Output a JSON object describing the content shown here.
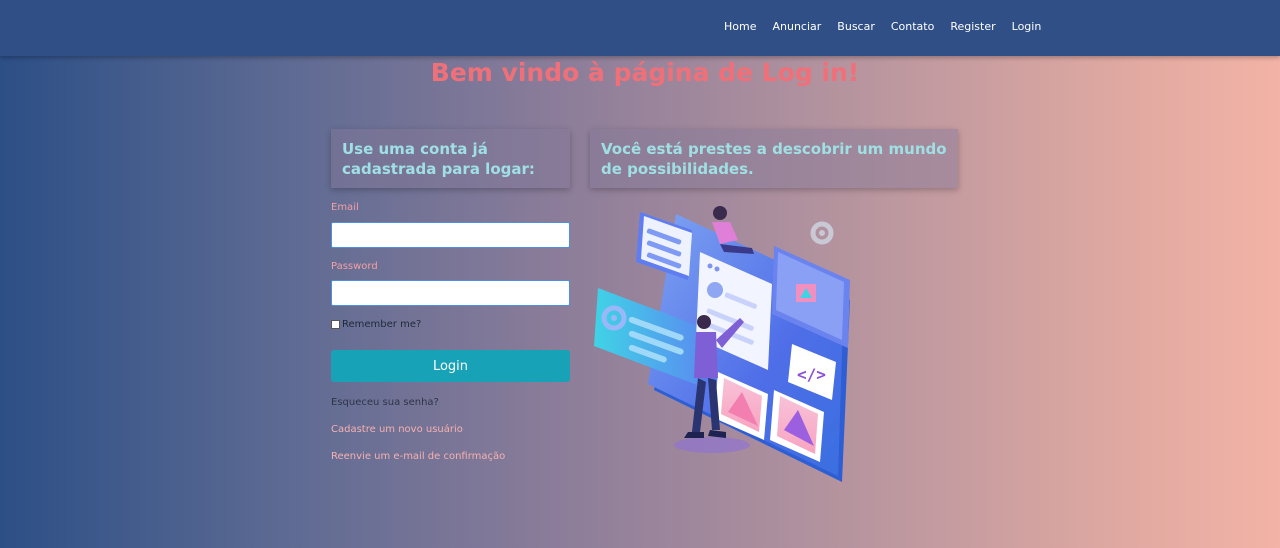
{
  "nav": {
    "items": [
      {
        "label": "Home"
      },
      {
        "label": "Anunciar"
      },
      {
        "label": "Buscar"
      },
      {
        "label": "Contato"
      },
      {
        "label": "Register"
      },
      {
        "label": "Login"
      }
    ]
  },
  "page": {
    "title": "Bem vindo à página de Log in!"
  },
  "login_card": {
    "heading": "Use uma conta já cadastrada para logar:"
  },
  "promo_card": {
    "heading": "Você está prestes a descobrir um mundo de possibilidades."
  },
  "form": {
    "email_label": "Email",
    "email_value": "",
    "password_label": "Password",
    "password_value": "",
    "remember_label": "Remember me?",
    "remember_checked": false,
    "submit_label": "Login"
  },
  "links": {
    "forgot": "Esqueceu sua senha?",
    "register": "Cadastre um novo usuário",
    "resend": "Reenvie um e-mail de confirmação"
  },
  "colors": {
    "navbar": "#2f4f86",
    "title": "#f0707a",
    "heading": "#9fe0e4",
    "button": "#17a2b8",
    "link": "#f6b0b0"
  },
  "icons": {
    "illustration": "web-design-illustration",
    "gear": "gear-icon"
  }
}
